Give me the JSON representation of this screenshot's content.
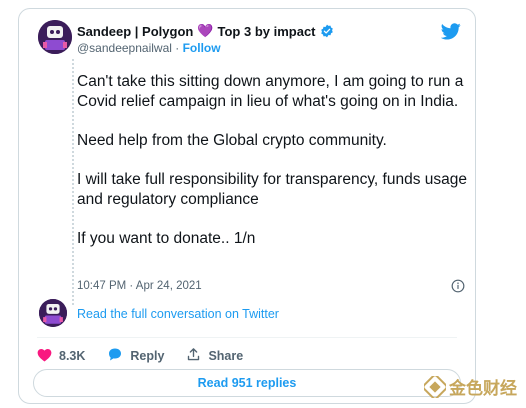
{
  "author": {
    "name": "Sandeep | Polygon",
    "heart": "💜",
    "title_suffix": "Top 3 by impact",
    "handle": "@sandeepnailwal",
    "separator": " · ",
    "follow_label": "Follow"
  },
  "tweet": {
    "paragraphs": [
      "Can't take this sitting down anymore, I am going to run a Covid relief campaign in lieu of what's going on in India.",
      "Need help from the Global crypto community.",
      "I will take full responsibility for transparency, funds usage and regulatory compliance",
      "If you want to donate.. 1/n"
    ],
    "timestamp": "10:47 PM · Apr 24, 2021"
  },
  "thread": {
    "read_full_label": "Read the full conversation on Twitter"
  },
  "actions": {
    "like_count": "8.3K",
    "reply_label": "Reply",
    "share_label": "Share",
    "read_replies_label": "Read 951 replies"
  },
  "watermark": {
    "text": "金色财经"
  },
  "colors": {
    "twitter_blue": "#1d9bf0",
    "like_red": "#f91880",
    "secondary_text": "#536471",
    "border": "#cfd9de",
    "watermark_gold": "#c7a75c"
  },
  "icons": {
    "bird": "twitter-bird-icon",
    "verified": "verified-badge-icon",
    "info": "info-icon",
    "heart": "heart-icon",
    "reply": "reply-bubble-icon",
    "share": "share-upload-icon"
  }
}
